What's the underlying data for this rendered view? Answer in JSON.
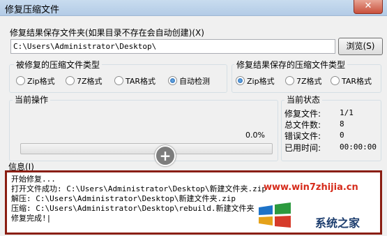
{
  "window": {
    "title": "修复压缩文件",
    "close_glyph": "✕"
  },
  "output": {
    "label": "修复结果保存文件夹(如果目录不存在会自动创建)(X)",
    "path_value": "C:\\Users\\Administrator\\Desktop\\",
    "browse_label": "浏览(S)"
  },
  "source_types": {
    "title": "被修复的压缩文件类型",
    "options": [
      {
        "label": "Zip格式",
        "selected": false
      },
      {
        "label": "7Z格式",
        "selected": false
      },
      {
        "label": "TAR格式",
        "selected": false
      },
      {
        "label": "自动检测",
        "selected": true
      }
    ]
  },
  "result_types": {
    "title": "修复结果保存的压缩文件类型",
    "options": [
      {
        "label": "Zip格式",
        "selected": true
      },
      {
        "label": "7Z格式",
        "selected": false
      },
      {
        "label": "TAR格式",
        "selected": false
      }
    ]
  },
  "current_operation": {
    "title": "当前操作",
    "percent_text": "0.0%",
    "progress": 0.0
  },
  "current_status": {
    "title": "当前状态",
    "rows": [
      {
        "key": "修复文件:",
        "value": "1/1"
      },
      {
        "key": "总文件数:",
        "value": "8"
      },
      {
        "key": "错误文件:",
        "value": "0"
      },
      {
        "key": "已用时间:",
        "value": "00:00:00"
      }
    ]
  },
  "info": {
    "label": "信息(I)",
    "lines": [
      "开始修复...",
      "打开文件成功: C:\\Users\\Administrator\\Desktop\\新建文件夹.zip",
      "解压: C:\\Users\\Administrator\\Desktop\\新建文件夹.zip",
      "压缩: C:\\Users\\Administrator\\Desktop\\rebuild.新建文件夹",
      "修复完成!|"
    ]
  },
  "watermark": {
    "url": "www.win7zhijia.cn",
    "site": "系统之家"
  },
  "icons": {
    "close": "close-icon",
    "add": "plus-circle-icon",
    "logo": "windows-logo-icon"
  },
  "colors": {
    "log_border": "#8a1e12",
    "watermark_red": "#d62b1b",
    "radio_selected": "#1e5ea8"
  }
}
